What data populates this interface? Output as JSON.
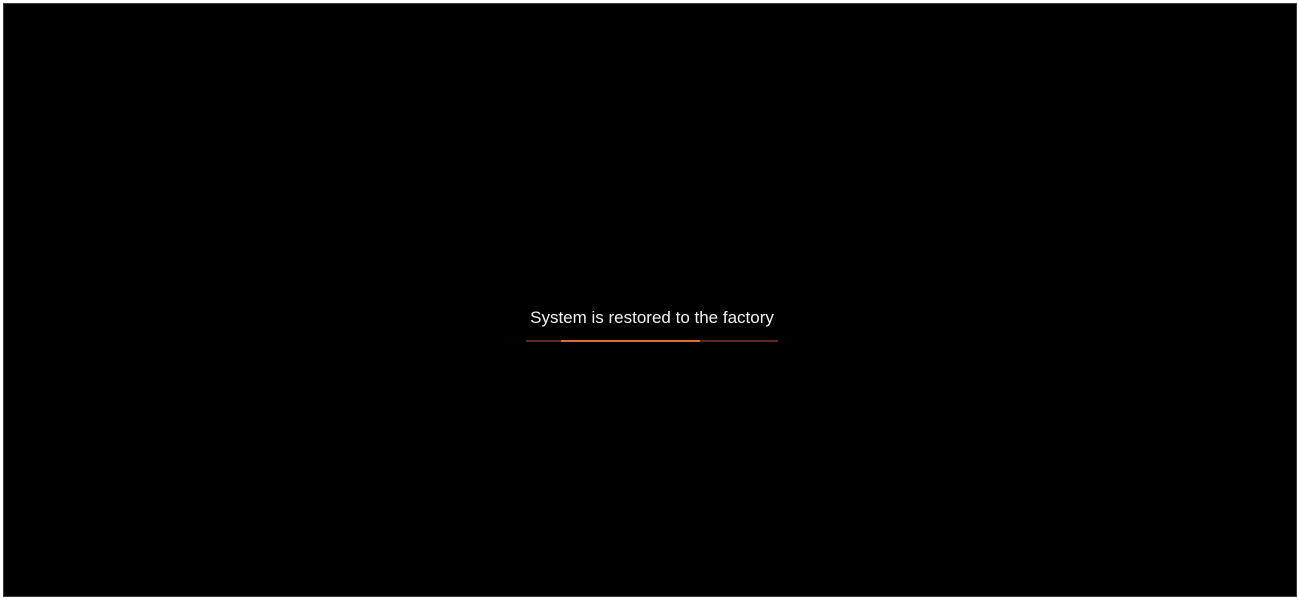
{
  "screen": {
    "background_color": "#000000"
  },
  "restore": {
    "status_text": "System is restored to the factory",
    "progress_bar": {
      "type": "indeterminate",
      "track_color": "#5a2a1a",
      "fill_color": "#e8692c",
      "segment_start_fraction": 0.14,
      "segment_length_fraction": 0.55
    }
  }
}
